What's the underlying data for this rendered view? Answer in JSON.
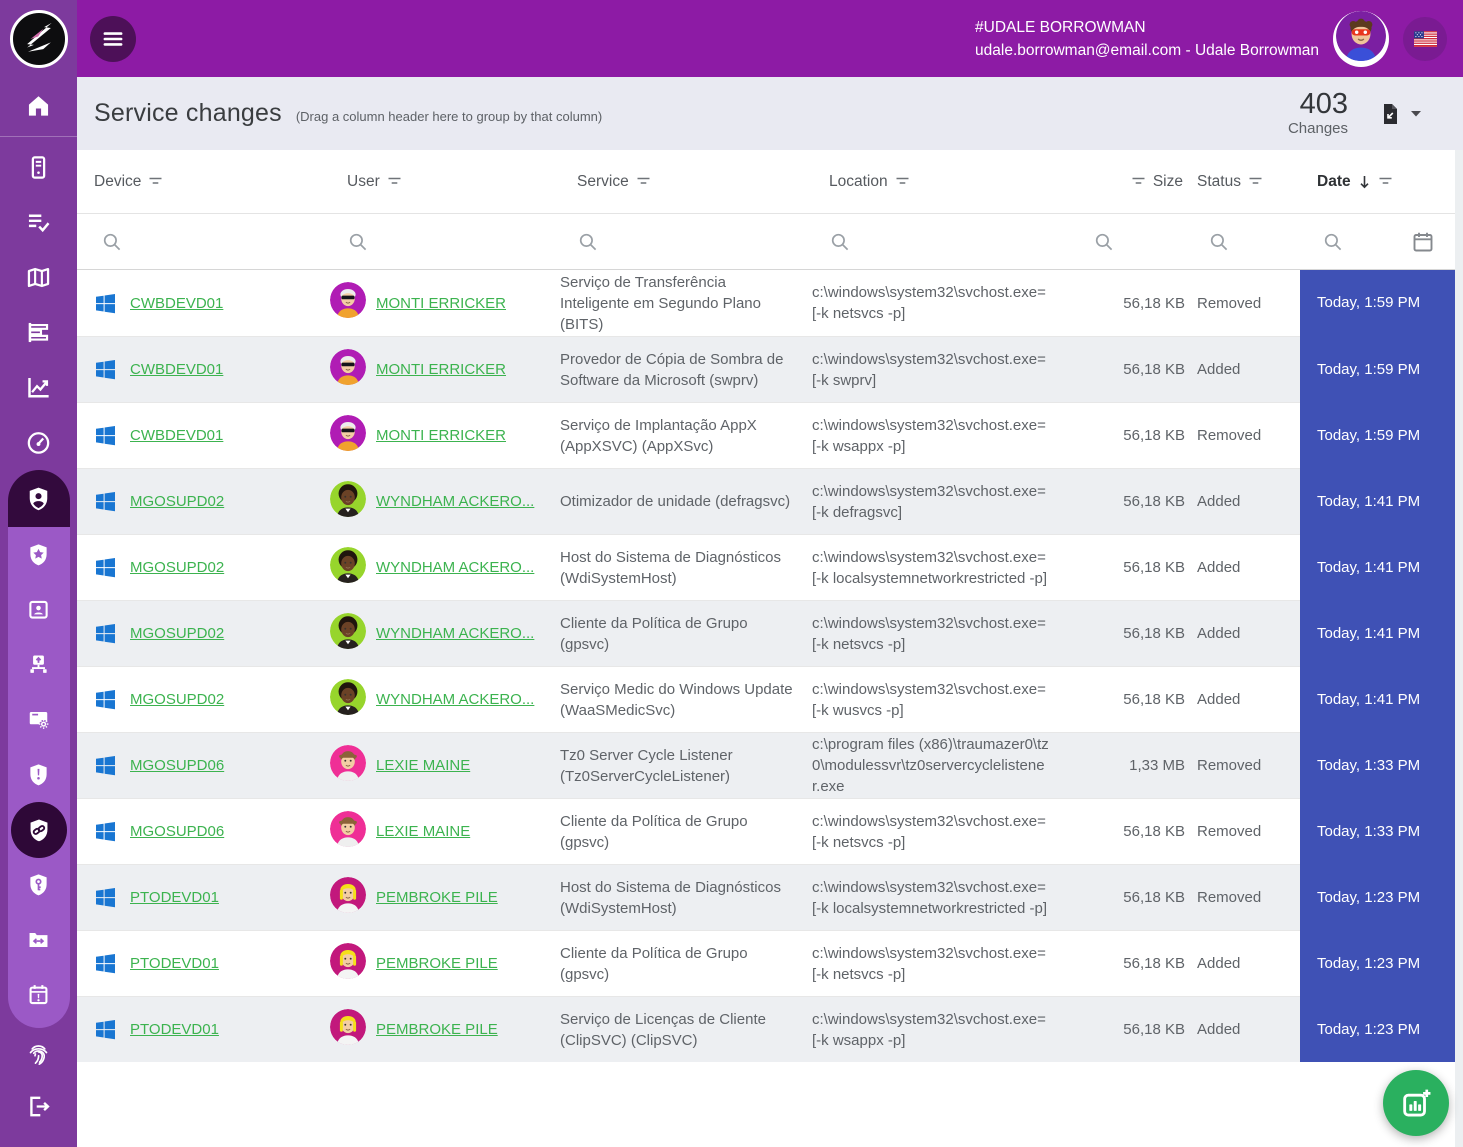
{
  "colors": {
    "topbar": "#8d1ba5",
    "sidebar": "#7d3a9d",
    "submenu": "#9b59c6",
    "active_dark": "#330a3d",
    "selected_dark": "#2e0837",
    "accent_green": "#3cb34f",
    "date_column": "#3f51b5",
    "fab_green": "#2ab05f",
    "row_alt": "#edeff2",
    "windows_blue": "#1976d2"
  },
  "topbar": {
    "account_name": "#UDALE BORROWMAN",
    "account_detail": "udale.borrowman@email.com - Udale Borrowman",
    "flag": "us-flag"
  },
  "header": {
    "title": "Service changes",
    "hint": "(Drag a column header here to group by that column)",
    "count": "403",
    "count_label": "Changes"
  },
  "columns": [
    {
      "key": "device",
      "label": "Device",
      "filter": "after"
    },
    {
      "key": "user",
      "label": "User",
      "filter": "after"
    },
    {
      "key": "service",
      "label": "Service",
      "filter": "after"
    },
    {
      "key": "location",
      "label": "Location",
      "filter": "after"
    },
    {
      "key": "size",
      "label": "Size",
      "filter": "before",
      "align": "right"
    },
    {
      "key": "status",
      "label": "Status",
      "filter": "after"
    },
    {
      "key": "date",
      "label": "Date",
      "filter": "after",
      "sorted": "desc",
      "bold": true
    }
  ],
  "avatars": {
    "monti": {
      "bg": "#b01cb4",
      "hair": "#ededed",
      "skin": "#f3cda4",
      "shirt": "#f0a22e",
      "variant": "sunglasses"
    },
    "wyndham": {
      "bg": "#97d52c",
      "hair": "#20150e",
      "skin": "#6b4226",
      "shirt": "#26211e",
      "variant": "afro"
    },
    "lexie": {
      "bg": "#ef2f96",
      "hair": "#8c6239",
      "skin": "#f3cda4",
      "shirt": "#efefef",
      "variant": "hat"
    },
    "pembroke": {
      "bg": "#c2187c",
      "hair": "#f5e01b",
      "skin": "#f3cda4",
      "shirt": "#f4f4f4",
      "variant": "blonde"
    },
    "udale": {
      "bg": "#7b1fa2",
      "hair": "#5b3a1e",
      "skin": "#f0c49a",
      "shirt": "#3a4fd8",
      "variant": "mask"
    }
  },
  "rows": [
    {
      "device": "CWBDEVD01",
      "user": "MONTI ERRICKER",
      "avatar": "monti",
      "service": "Serviço de Transferência Inteligente em Segundo Plano (BITS)",
      "location": "c:\\windows\\system32\\svchost.exe=[-k netsvcs -p]",
      "size": "56,18 KB",
      "status": "Removed",
      "date": "Today, 1:59 PM"
    },
    {
      "device": "CWBDEVD01",
      "user": "MONTI ERRICKER",
      "avatar": "monti",
      "service": "Provedor de Cópia de Sombra de Software da Microsoft (swprv)",
      "location": "c:\\windows\\system32\\svchost.exe=[-k swprv]",
      "size": "56,18 KB",
      "status": "Added",
      "date": "Today, 1:59 PM"
    },
    {
      "device": "CWBDEVD01",
      "user": "MONTI ERRICKER",
      "avatar": "monti",
      "service": "Serviço de Implantação AppX (AppXSVC) (AppXSvc)",
      "location": "c:\\windows\\system32\\svchost.exe=[-k wsappx -p]",
      "size": "56,18 KB",
      "status": "Removed",
      "date": "Today, 1:59 PM"
    },
    {
      "device": "MGOSUPD02",
      "user": "WYNDHAM ACKERO...",
      "avatar": "wyndham",
      "service": "Otimizador de unidade (defragsvc)",
      "location": "c:\\windows\\system32\\svchost.exe=[-k defragsvc]",
      "size": "56,18 KB",
      "status": "Added",
      "date": "Today, 1:41 PM"
    },
    {
      "device": "MGOSUPD02",
      "user": "WYNDHAM ACKERO...",
      "avatar": "wyndham",
      "service": "Host do Sistema de Diagnósticos (WdiSystemHost)",
      "location": "c:\\windows\\system32\\svchost.exe=[-k localsystemnetworkrestricted -p]",
      "size": "56,18 KB",
      "status": "Added",
      "date": "Today, 1:41 PM"
    },
    {
      "device": "MGOSUPD02",
      "user": "WYNDHAM ACKERO...",
      "avatar": "wyndham",
      "service": "Cliente da Política de Grupo (gpsvc)",
      "location": "c:\\windows\\system32\\svchost.exe=[-k netsvcs -p]",
      "size": "56,18 KB",
      "status": "Added",
      "date": "Today, 1:41 PM"
    },
    {
      "device": "MGOSUPD02",
      "user": "WYNDHAM ACKERO...",
      "avatar": "wyndham",
      "service": "Serviço Medic do Windows Update (WaaSMedicSvc)",
      "location": "c:\\windows\\system32\\svchost.exe=[-k wusvcs -p]",
      "size": "56,18 KB",
      "status": "Added",
      "date": "Today, 1:41 PM"
    },
    {
      "device": "MGOSUPD06",
      "user": "LEXIE MAINE",
      "avatar": "lexie",
      "service": "Tz0 Server Cycle Listener (Tz0ServerCycleListener)",
      "location": "c:\\program files (x86)\\traumazer0\\tz0\\modulessvr\\tz0servercyclelistener.exe",
      "size": "1,33 MB",
      "status": "Removed",
      "date": "Today, 1:33 PM"
    },
    {
      "device": "MGOSUPD06",
      "user": "LEXIE MAINE",
      "avatar": "lexie",
      "service": "Cliente da Política de Grupo (gpsvc)",
      "location": "c:\\windows\\system32\\svchost.exe=[-k netsvcs -p]",
      "size": "56,18 KB",
      "status": "Removed",
      "date": "Today, 1:33 PM"
    },
    {
      "device": "PTODEVD01",
      "user": "PEMBROKE PILE",
      "avatar": "pembroke",
      "service": "Host do Sistema de Diagnósticos (WdiSystemHost)",
      "location": "c:\\windows\\system32\\svchost.exe=[-k localsystemnetworkrestricted -p]",
      "size": "56,18 KB",
      "status": "Removed",
      "date": "Today, 1:23 PM"
    },
    {
      "device": "PTODEVD01",
      "user": "PEMBROKE PILE",
      "avatar": "pembroke",
      "service": "Cliente da Política de Grupo (gpsvc)",
      "location": "c:\\windows\\system32\\svchost.exe=[-k netsvcs -p]",
      "size": "56,18 KB",
      "status": "Added",
      "date": "Today, 1:23 PM"
    },
    {
      "device": "PTODEVD01",
      "user": "PEMBROKE PILE",
      "avatar": "pembroke",
      "service": "Serviço de Licenças de Cliente (ClipSVC) (ClipSVC)",
      "location": "c:\\windows\\system32\\svchost.exe=[-k wsappx -p]",
      "size": "56,18 KB",
      "status": "Added",
      "date": "Today, 1:23 PM"
    }
  ],
  "sidebar": {
    "items": [
      {
        "icon": "home",
        "divider_after": true
      },
      {
        "icon": "devices"
      },
      {
        "icon": "task-list"
      },
      {
        "icon": "map"
      },
      {
        "icon": "bar-chart"
      },
      {
        "icon": "line-chart"
      },
      {
        "icon": "gauge"
      },
      {
        "icon": "shield-user",
        "state": "active-parent"
      },
      {
        "icon": "shield-star",
        "group": true
      },
      {
        "icon": "id-card",
        "group": true
      },
      {
        "icon": "net-upload",
        "group": true
      },
      {
        "icon": "window-gear",
        "group": true
      },
      {
        "icon": "shield-alert",
        "group": true
      },
      {
        "icon": "shield-link",
        "group": true,
        "state": "selected"
      },
      {
        "icon": "shield-key",
        "group": true
      },
      {
        "icon": "folder-sync",
        "group": true
      },
      {
        "icon": "calendar-alert",
        "group": true
      }
    ],
    "bottom_items": [
      {
        "icon": "fingerprint"
      },
      {
        "icon": "logout"
      }
    ]
  },
  "fab": {
    "icon": "add-chart"
  }
}
